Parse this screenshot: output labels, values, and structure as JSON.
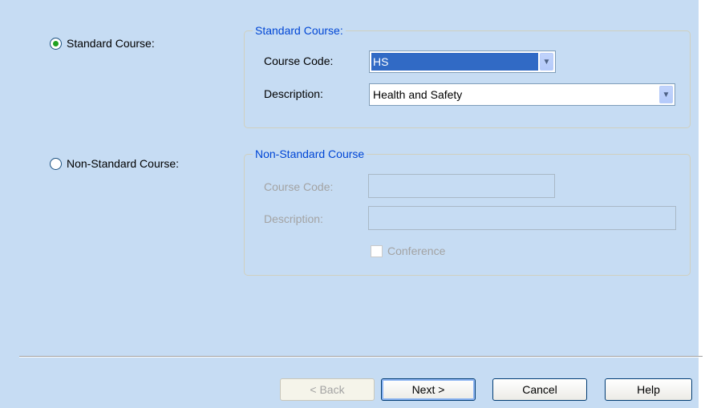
{
  "course_type": {
    "standard_radio_label": "Standard Course:",
    "standard_selected": true,
    "nonstandard_radio_label": "Non-Standard Course:",
    "nonstandard_selected": false
  },
  "standard_group": {
    "title": "Standard Course:",
    "course_code_label": "Course Code:",
    "course_code_value": "HS",
    "description_label": "Description:",
    "description_value": "Health and Safety"
  },
  "nonstandard_group": {
    "title": "Non-Standard Course",
    "course_code_label": "Course Code:",
    "course_code_value": "",
    "description_label": "Description:",
    "description_value": "",
    "conference_label": "Conference",
    "conference_checked": false
  },
  "buttons": {
    "back": "< Back",
    "next": "Next >",
    "cancel": "Cancel",
    "help": "Help"
  },
  "icons": {
    "dropdown": "chevron-down-icon"
  }
}
